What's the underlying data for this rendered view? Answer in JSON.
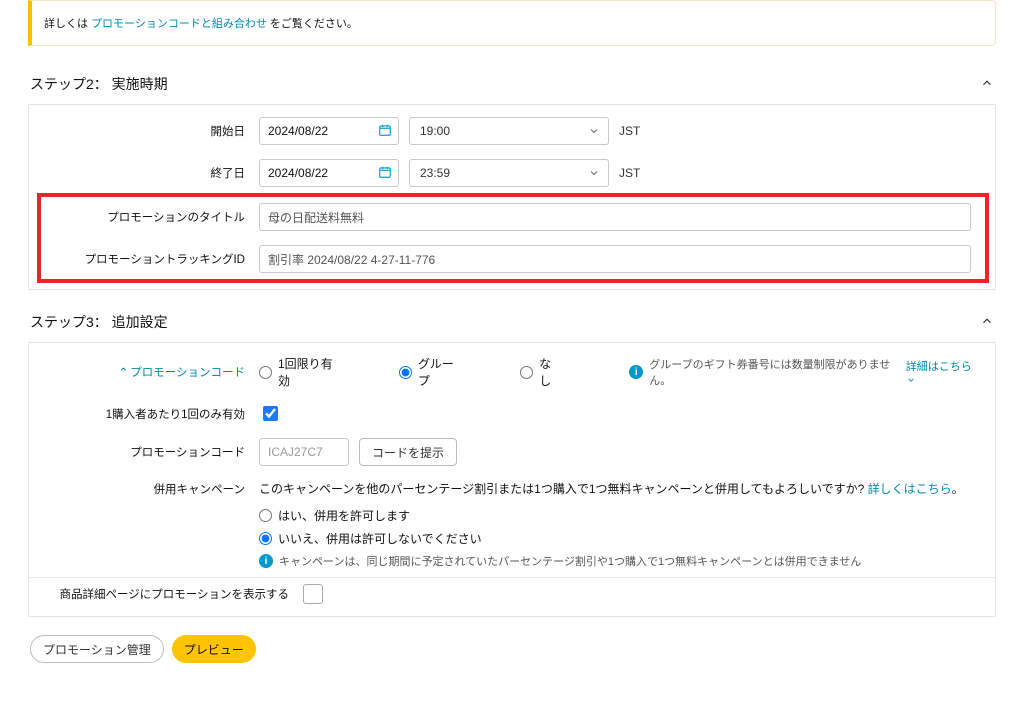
{
  "info_bar": {
    "prefix": "詳しくは",
    "link_text": "プロモーションコードと組み合わせ",
    "suffix": "をご覧ください。"
  },
  "step2": {
    "title": "ステップ2： 実施時期",
    "start_label": "開始日",
    "start_date": "2024/08/22",
    "start_time": "19:00",
    "start_tz": "JST",
    "end_label": "終了日",
    "end_date": "2024/08/22",
    "end_time": "23:59",
    "end_tz": "JST",
    "promo_title_label": "プロモーションのタイトル",
    "promo_title_value": "母の日配送料無料",
    "tracking_label": "プロモーショントラッキングID",
    "tracking_value": "割引率 2024/08/22 4-27-11-776"
  },
  "step3": {
    "title": "ステップ3： 追加設定",
    "code_label": "プロモーションコード",
    "radio_once": "1回限り有効",
    "radio_group": "グループ",
    "radio_none": "なし",
    "group_note": "グループのギフト券番号には数量制限がありません。",
    "group_note_link": "詳細はこちら",
    "one_per_buyer_label": "1購入者あたり1回のみ有効",
    "promo_code_label": "プロモーションコード",
    "promo_code_value": "ICAJ27C7",
    "btn_suggest": "コードを提示",
    "campaign_label": "併用キャンペーン",
    "campaign_q": "このキャンペーンを他のパーセンテージ割引または1つ購入で1つ無料キャンペーンと併用してもよろしいですか?",
    "campaign_link": "詳しくはこちら",
    "radio_yes": "はい、併用を許可します",
    "radio_no": "いいえ、併用は許可しないでください",
    "campaign_note": "キャンペーンは、同じ期間に予定されていたパーセンテージ割引や1つ購入で1つ無料キャンペーンとは併用できません",
    "show_on_detail_label": "商品詳細ページにプロモーションを表示する"
  },
  "footer": {
    "btn_manage": "プロモーション管理",
    "btn_preview": "プレビュー"
  }
}
